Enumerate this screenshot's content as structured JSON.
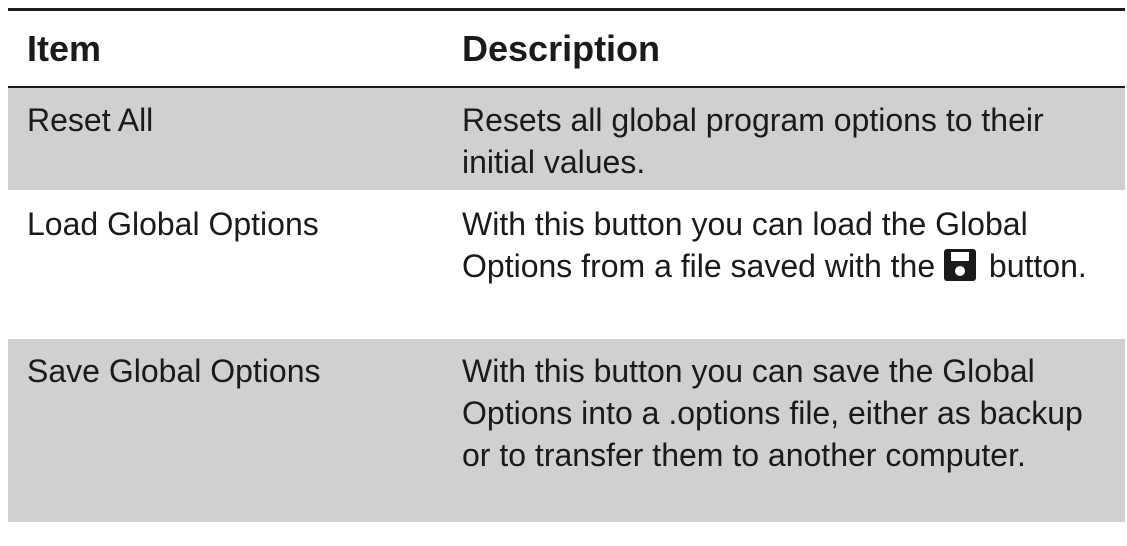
{
  "table": {
    "headers": {
      "item": "Item",
      "description": "Description"
    },
    "rows": [
      {
        "item": "Reset All",
        "description": "Resets all global program options to their initial values."
      },
      {
        "item": "Load Global Options",
        "description_before_icon": "With this button you can load the Global Options from a file saved with the",
        "icon": "floppy-disk-icon",
        "description_after_icon": " button."
      },
      {
        "item": "Save Global Options",
        "description": "With this button you can save the Global Options into a .options file, either as backup or to transfer them to another computer."
      }
    ]
  },
  "colors": {
    "shaded_row": "#d0d0d0",
    "rule": "#1a1a1a"
  }
}
